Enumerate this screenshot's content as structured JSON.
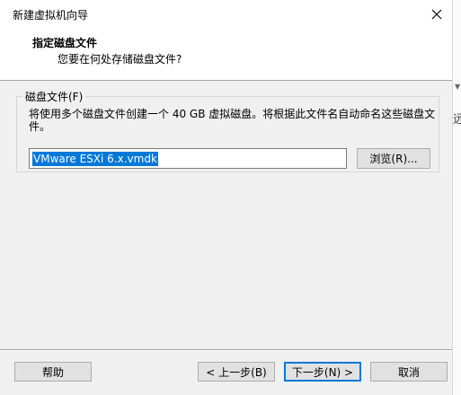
{
  "window": {
    "title": "新建虚拟机向导",
    "close_glyph": "✕"
  },
  "header": {
    "title": "指定磁盘文件",
    "subtitle": "您要在何处存储磁盘文件?"
  },
  "disk_file_group": {
    "label": "磁盘文件(F)",
    "description": "将使用多个磁盘文件创建一个 40 GB 虚拟磁盘。将根据此文件名自动命名这些磁盘文件。",
    "file_value": "VMware ESXi 6.x.vmdk",
    "browse_label": "浏览(R)..."
  },
  "footer": {
    "help_label": "帮助",
    "back_label": "< 上一步(B)",
    "next_label": "下一步(N) >",
    "cancel_label": "取消"
  },
  "background": {
    "right_edge_char": "远"
  }
}
